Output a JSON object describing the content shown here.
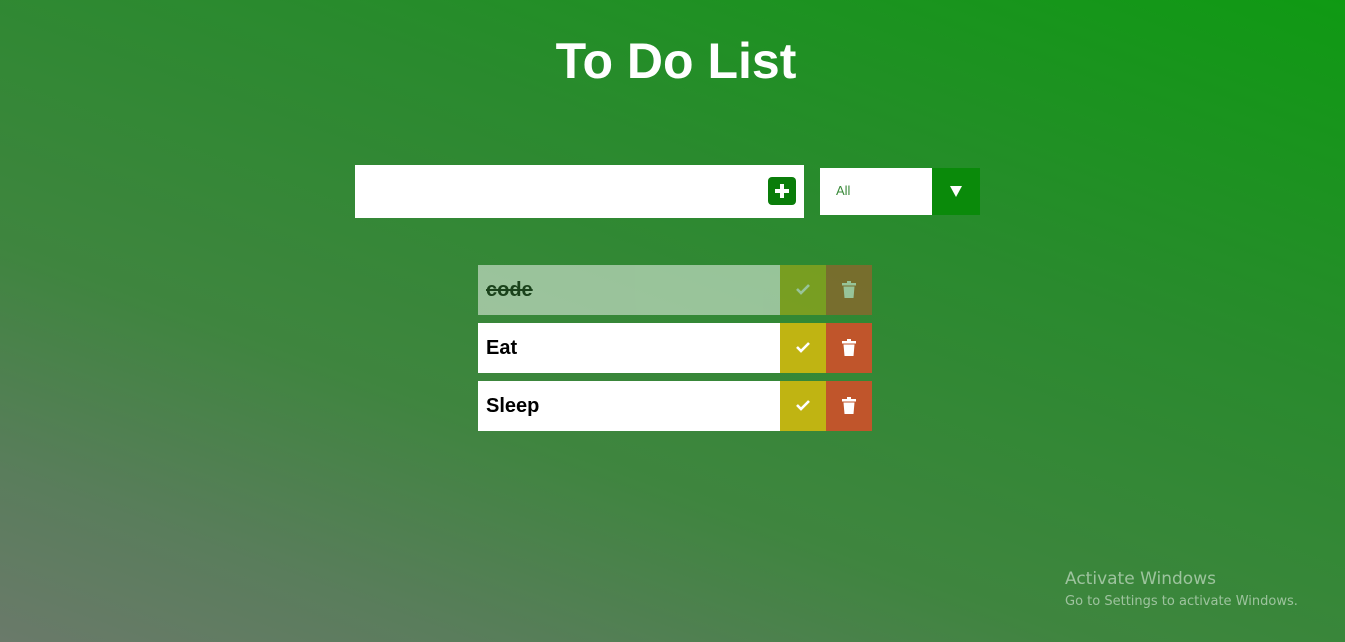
{
  "header": {
    "title": "To Do List"
  },
  "form": {
    "input_value": "",
    "add_icon": "plus-icon",
    "filter_selected": "All",
    "filter_icon": "triangle-down-icon",
    "accent_color": "#0a8a0a"
  },
  "todos": [
    {
      "text": "code",
      "completed": true
    },
    {
      "text": "Eat",
      "completed": false
    },
    {
      "text": "Sleep",
      "completed": false
    }
  ],
  "item_icons": {
    "complete": "check-icon",
    "delete": "trash-icon"
  },
  "colors": {
    "complete": "#c0b412",
    "delete": "#c0552b"
  },
  "watermark": {
    "title": "Activate Windows",
    "subtitle": "Go to Settings to activate Windows."
  }
}
